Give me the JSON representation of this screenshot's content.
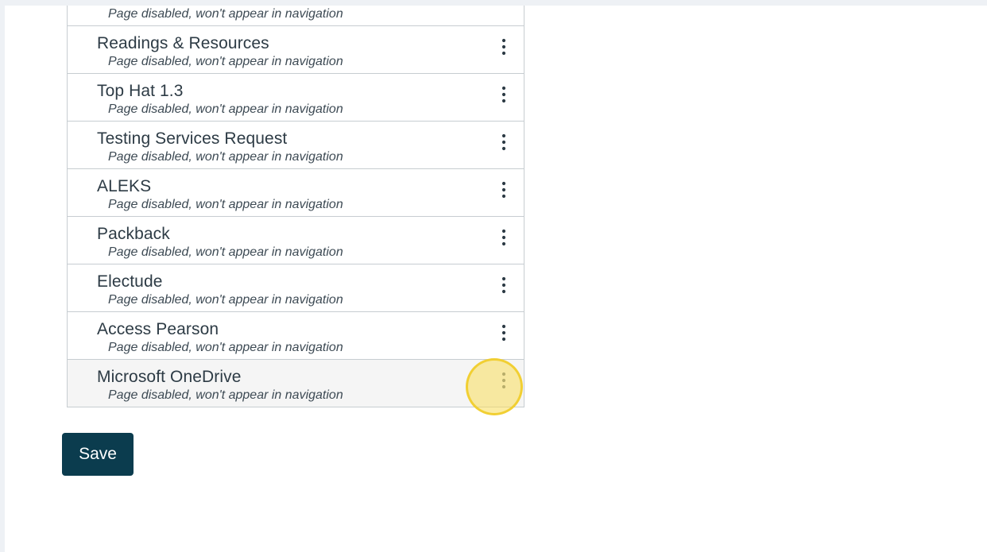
{
  "navigation": {
    "items": [
      {
        "label": "",
        "status": "Page disabled, won't appear in navigation"
      },
      {
        "label": "Readings & Resources",
        "status": "Page disabled, won't appear in navigation"
      },
      {
        "label": "Top Hat 1.3",
        "status": "Page disabled, won't appear in navigation"
      },
      {
        "label": "Testing Services Request",
        "status": "Page disabled, won't appear in navigation"
      },
      {
        "label": "ALEKS",
        "status": "Page disabled, won't appear in navigation"
      },
      {
        "label": "Packback",
        "status": "Page disabled, won't appear in navigation"
      },
      {
        "label": "Electude",
        "status": "Page disabled, won't appear in navigation"
      },
      {
        "label": "Access Pearson",
        "status": "Page disabled, won't appear in navigation"
      },
      {
        "label": "Microsoft OneDrive",
        "status": "Page disabled, won't appear in navigation"
      }
    ],
    "menu_icon": "vertical-ellipsis-icon"
  },
  "actions": {
    "save_label": "Save"
  },
  "colors": {
    "save_button": "#0b3c4e",
    "click_highlight": "#f7dd5a",
    "border": "#c7cdd1",
    "text": "#2d3b45"
  }
}
